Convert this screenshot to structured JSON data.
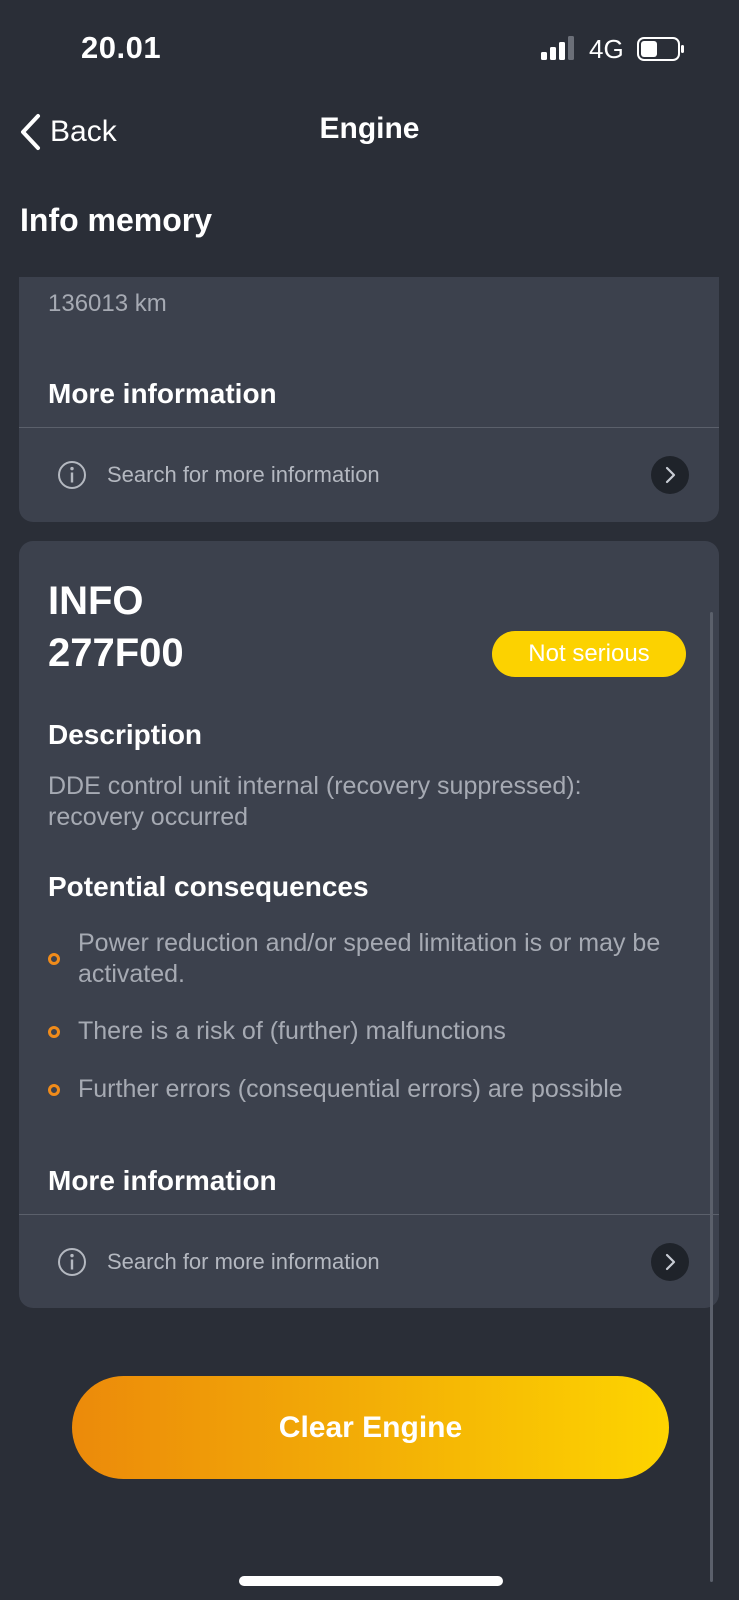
{
  "status_bar": {
    "time": "20.01",
    "network": "4G"
  },
  "nav": {
    "back_label": "Back",
    "title": "Engine"
  },
  "section_title": "Info memory",
  "previous_card": {
    "mileage": "136013 km",
    "more_info_title": "More information",
    "search_label": "Search for more information"
  },
  "fault_card": {
    "type": "INFO",
    "code": "277F00",
    "severity": "Not serious",
    "description_title": "Description",
    "description": "DDE control unit internal (recovery suppressed): recovery occurred",
    "consequences_title": "Potential consequences",
    "consequences": [
      "Power reduction and/or speed limitation is or may be activated.",
      "There is a risk of (further) malfunctions",
      "Further errors (consequential errors) are possible"
    ],
    "more_info_title": "More information",
    "search_label": "Search for more information"
  },
  "clear_button_label": "Clear Engine",
  "colors": {
    "background": "#2a2e37",
    "card": "#3c414d",
    "badge": "#fcd200",
    "accent": "#f08b1a"
  },
  "icons": [
    "signal-icon",
    "battery-icon",
    "back-chevron-icon",
    "info-icon",
    "chevron-right-icon"
  ]
}
